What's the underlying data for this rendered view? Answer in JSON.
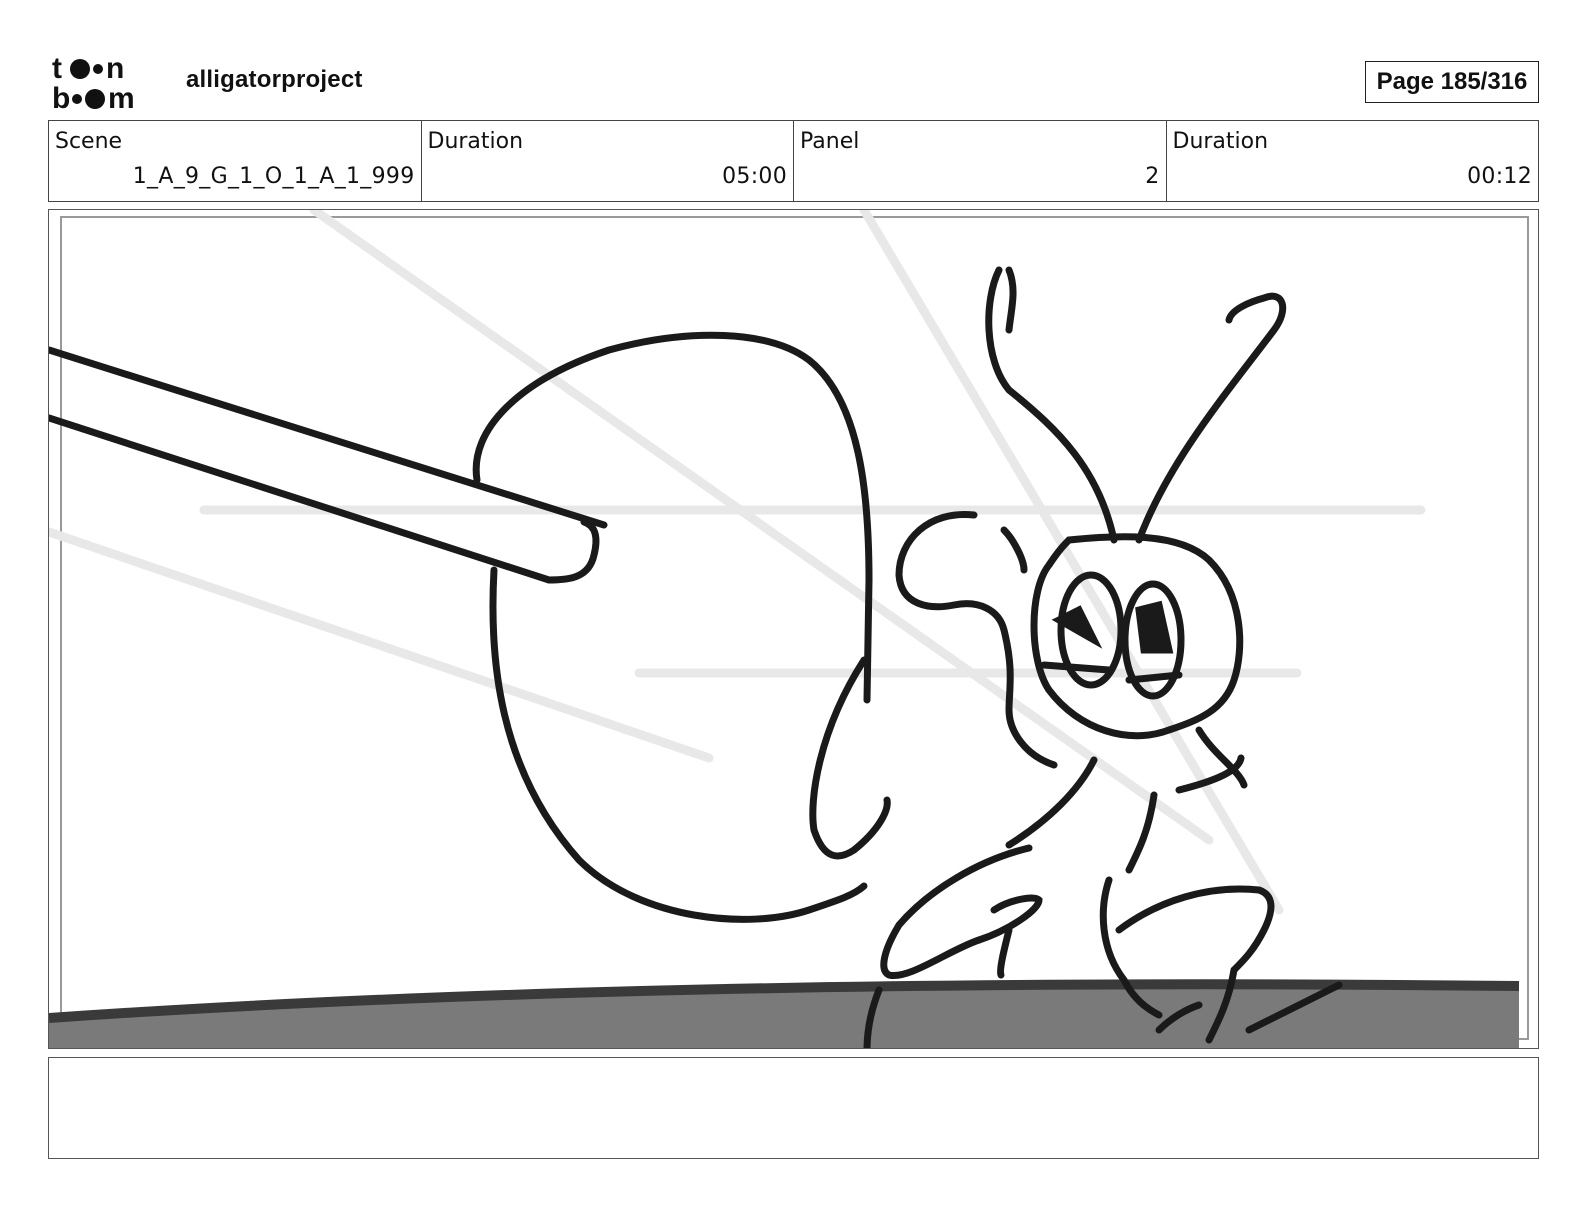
{
  "header": {
    "logo_text": "toon boom",
    "project_name": "alligatorproject",
    "page_label": "Page 185/316"
  },
  "info": {
    "scene_label": "Scene",
    "scene_value": "1_A_9_G_1_O_1_A_1_999",
    "scene_duration_label": "Duration",
    "scene_duration_value": "05:00",
    "panel_label": "Panel",
    "panel_value": "2",
    "panel_duration_label": "Duration",
    "panel_duration_value": "00:12"
  },
  "notes": {
    "text": ""
  },
  "colors": {
    "stroke": "#1a1a1a",
    "ground": "#7a7a7a",
    "guide_lines": "#e6e6e6"
  }
}
